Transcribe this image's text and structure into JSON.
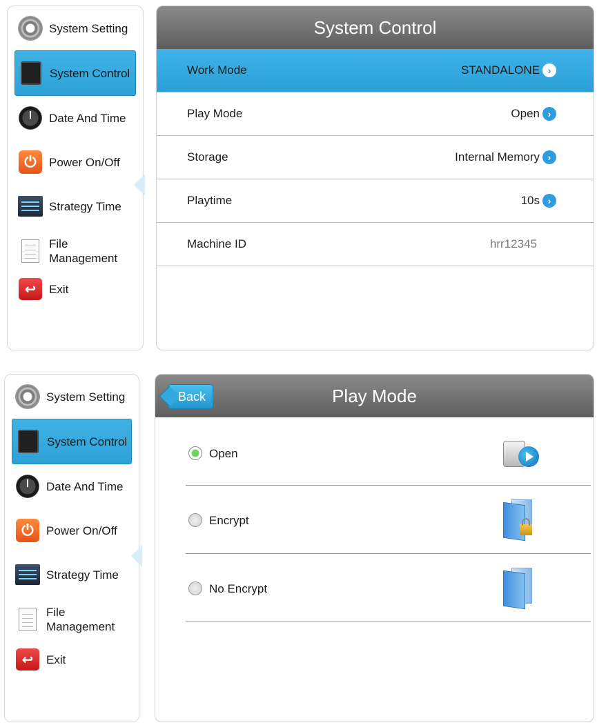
{
  "sidebar": {
    "items": [
      {
        "label": "System Setting",
        "icon": "gear-icon"
      },
      {
        "label": "System Control",
        "icon": "tablet-icon",
        "active": true
      },
      {
        "label": "Date And Time",
        "icon": "clock-icon"
      },
      {
        "label": "Power On/Off",
        "icon": "power-icon"
      },
      {
        "label": "Strategy Time",
        "icon": "sliders-icon"
      },
      {
        "label": "File\nManagement",
        "icon": "file-icon"
      },
      {
        "label": "Exit",
        "icon": "exit-icon"
      }
    ]
  },
  "system_control": {
    "title": "System Control",
    "rows": [
      {
        "label": "Work Mode",
        "value": "STANDALONE",
        "selected": true
      },
      {
        "label": "Play Mode",
        "value": "Open"
      },
      {
        "label": "Storage",
        "value": "Internal Memory"
      },
      {
        "label": "Playtime",
        "value": "10s"
      },
      {
        "label": "Machine ID",
        "value": "hrr12345"
      }
    ]
  },
  "play_mode": {
    "title": "Play Mode",
    "back_label": "Back",
    "options": [
      {
        "label": "Open",
        "selected": true,
        "icon": "usb-play-icon"
      },
      {
        "label": "Encrypt",
        "selected": false,
        "icon": "locked-folder-icon"
      },
      {
        "label": "No Encrypt",
        "selected": false,
        "icon": "folder-icon"
      }
    ]
  },
  "colors": {
    "accent": "#2ea1d6",
    "header": "#6e6e6e",
    "radio_selected": "#6fd45a"
  }
}
